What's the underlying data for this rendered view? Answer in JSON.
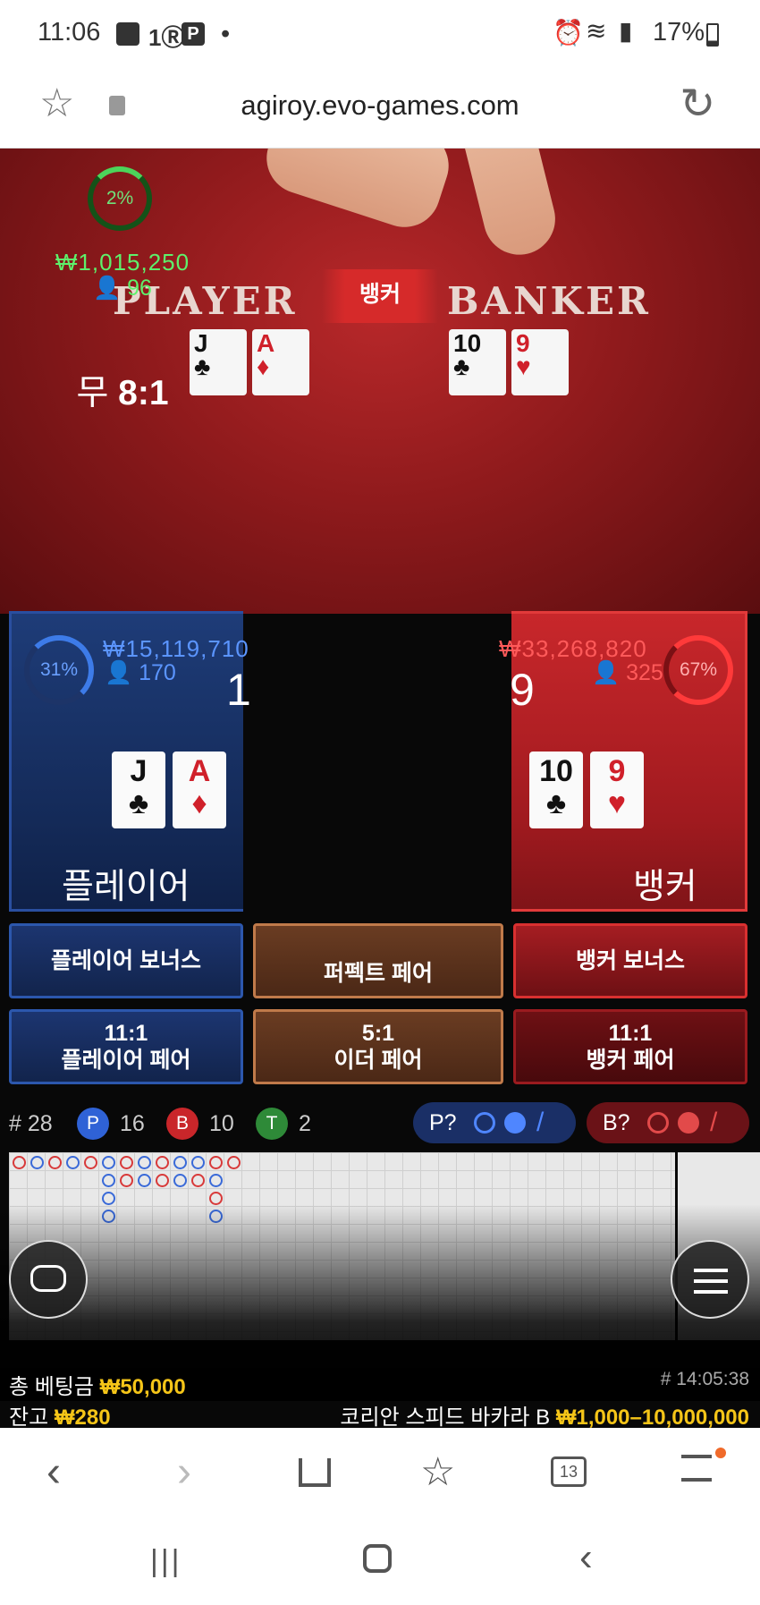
{
  "status": {
    "time": "11:06",
    "battery": "17%"
  },
  "browser": {
    "url": "agiroy.evo-games.com"
  },
  "table": {
    "player_word": "PLAYER",
    "banker_word": "BANKER",
    "winner_banner": "뱅커"
  },
  "player": {
    "percent": "31%",
    "amount": "₩15,119,710",
    "count": "170",
    "score": "1",
    "label": "플레이어",
    "cards": [
      {
        "rank": "J",
        "suit": "♣",
        "color": "#111"
      },
      {
        "rank": "A",
        "suit": "♦",
        "color": "#d0202a"
      }
    ]
  },
  "tie": {
    "percent": "2%",
    "amount": "₩1,015,250",
    "count": "96",
    "label": "무",
    "odds": "8:1"
  },
  "banker": {
    "percent": "67%",
    "amount": "₩33,268,820",
    "count": "325",
    "score": "9",
    "label": "뱅커",
    "cards": [
      {
        "rank": "10",
        "suit": "♣",
        "color": "#111"
      },
      {
        "rank": "9",
        "suit": "♥",
        "color": "#d0202a"
      }
    ]
  },
  "side_bets": {
    "player_bonus": "플레이어 보너스",
    "perfect_pair": "퍼펙트 페어",
    "banker_bonus": "뱅커 보너스",
    "player_pair_odds": "11:1",
    "player_pair": "플레이어 페어",
    "either_pair_odds": "5:1",
    "either_pair": "이더 페어",
    "banker_pair_odds": "11:1",
    "banker_pair": "뱅커 페어"
  },
  "stats": {
    "round": "# 28",
    "p_label": "P",
    "p_count": "16",
    "b_label": "B",
    "b_count": "10",
    "t_label": "T",
    "t_count": "2",
    "p_predict": "P?",
    "b_predict": "B?"
  },
  "bottom": {
    "total_bet_label": "총 베팅금",
    "total_bet": "₩50,000",
    "balance_label": "잔고",
    "balance": "₩280",
    "round_time": "# 14:05:38",
    "table_name": "코리안 스피드 바카라 B",
    "limits": "₩1,000–10,000,000"
  },
  "nav": {
    "tabs_count": "13"
  },
  "colors": {
    "player": "#1e3c78",
    "banker": "#c8272b",
    "tie": "#1d6a22",
    "gold": "#f5c518"
  }
}
